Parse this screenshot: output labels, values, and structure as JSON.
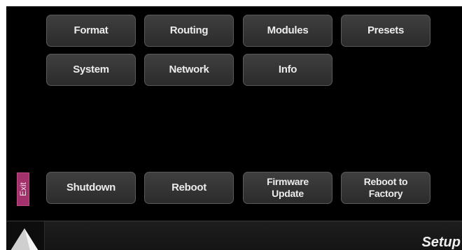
{
  "menu": {
    "row1": [
      {
        "label": "Format"
      },
      {
        "label": "Routing"
      },
      {
        "label": "Modules"
      },
      {
        "label": "Presets"
      }
    ],
    "row2": [
      {
        "label": "System"
      },
      {
        "label": "Network"
      },
      {
        "label": "Info"
      }
    ]
  },
  "actions": {
    "exit": "Exit",
    "shutdown": "Shutdown",
    "reboot": "Reboot",
    "firmware_update": [
      "Firmware",
      "Update"
    ],
    "reboot_to_factory": [
      "Reboot to",
      "Factory"
    ]
  },
  "footer": {
    "page_label": "Setup",
    "home_icon": "triangle-icon"
  },
  "colors": {
    "background": "#000000",
    "button": "#333333",
    "exit": "#a3316b"
  }
}
